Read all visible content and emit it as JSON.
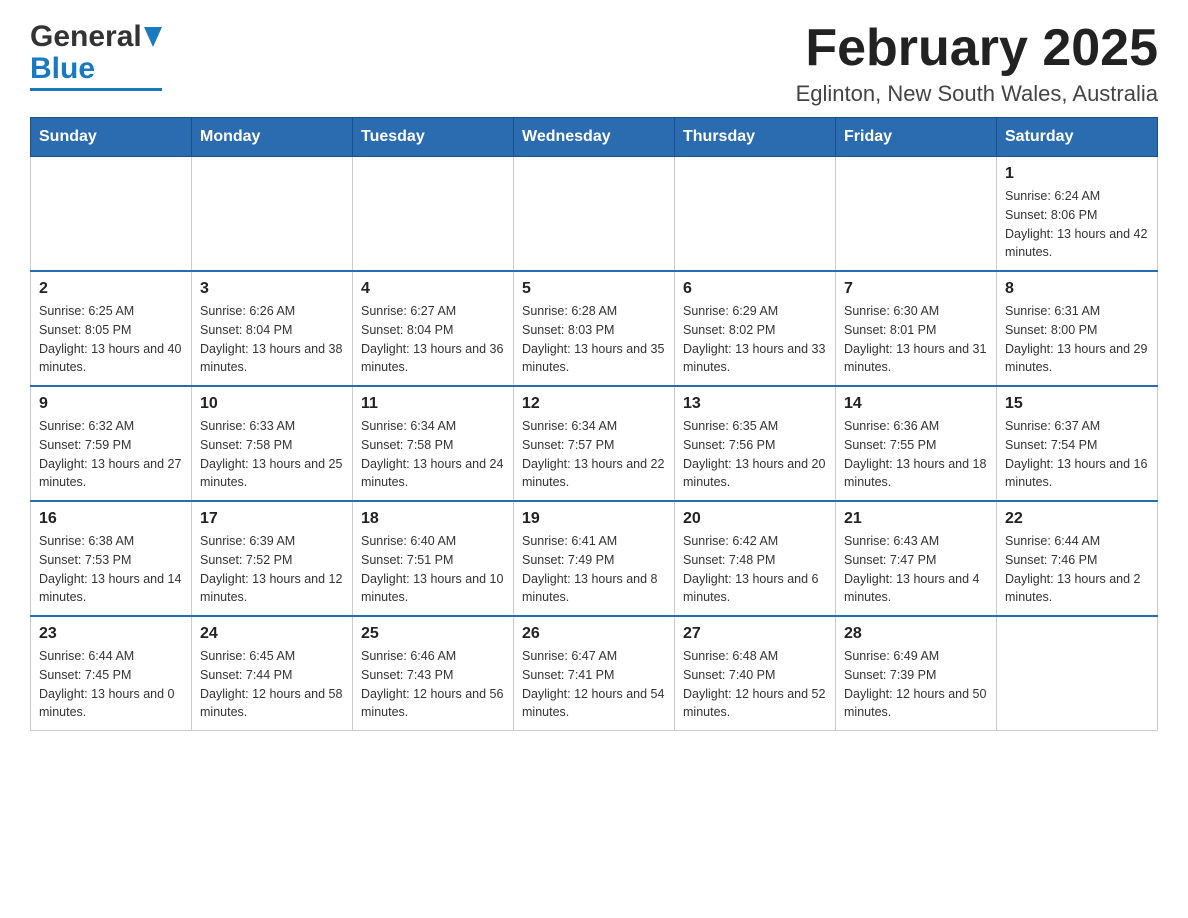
{
  "header": {
    "logo_general": "General",
    "logo_blue": "Blue",
    "title": "February 2025",
    "subtitle": "Eglinton, New South Wales, Australia"
  },
  "weekdays": [
    "Sunday",
    "Monday",
    "Tuesday",
    "Wednesday",
    "Thursday",
    "Friday",
    "Saturday"
  ],
  "weeks": [
    {
      "days": [
        {
          "num": "",
          "info": ""
        },
        {
          "num": "",
          "info": ""
        },
        {
          "num": "",
          "info": ""
        },
        {
          "num": "",
          "info": ""
        },
        {
          "num": "",
          "info": ""
        },
        {
          "num": "",
          "info": ""
        },
        {
          "num": "1",
          "info": "Sunrise: 6:24 AM\nSunset: 8:06 PM\nDaylight: 13 hours and 42 minutes."
        }
      ]
    },
    {
      "days": [
        {
          "num": "2",
          "info": "Sunrise: 6:25 AM\nSunset: 8:05 PM\nDaylight: 13 hours and 40 minutes."
        },
        {
          "num": "3",
          "info": "Sunrise: 6:26 AM\nSunset: 8:04 PM\nDaylight: 13 hours and 38 minutes."
        },
        {
          "num": "4",
          "info": "Sunrise: 6:27 AM\nSunset: 8:04 PM\nDaylight: 13 hours and 36 minutes."
        },
        {
          "num": "5",
          "info": "Sunrise: 6:28 AM\nSunset: 8:03 PM\nDaylight: 13 hours and 35 minutes."
        },
        {
          "num": "6",
          "info": "Sunrise: 6:29 AM\nSunset: 8:02 PM\nDaylight: 13 hours and 33 minutes."
        },
        {
          "num": "7",
          "info": "Sunrise: 6:30 AM\nSunset: 8:01 PM\nDaylight: 13 hours and 31 minutes."
        },
        {
          "num": "8",
          "info": "Sunrise: 6:31 AM\nSunset: 8:00 PM\nDaylight: 13 hours and 29 minutes."
        }
      ]
    },
    {
      "days": [
        {
          "num": "9",
          "info": "Sunrise: 6:32 AM\nSunset: 7:59 PM\nDaylight: 13 hours and 27 minutes."
        },
        {
          "num": "10",
          "info": "Sunrise: 6:33 AM\nSunset: 7:58 PM\nDaylight: 13 hours and 25 minutes."
        },
        {
          "num": "11",
          "info": "Sunrise: 6:34 AM\nSunset: 7:58 PM\nDaylight: 13 hours and 24 minutes."
        },
        {
          "num": "12",
          "info": "Sunrise: 6:34 AM\nSunset: 7:57 PM\nDaylight: 13 hours and 22 minutes."
        },
        {
          "num": "13",
          "info": "Sunrise: 6:35 AM\nSunset: 7:56 PM\nDaylight: 13 hours and 20 minutes."
        },
        {
          "num": "14",
          "info": "Sunrise: 6:36 AM\nSunset: 7:55 PM\nDaylight: 13 hours and 18 minutes."
        },
        {
          "num": "15",
          "info": "Sunrise: 6:37 AM\nSunset: 7:54 PM\nDaylight: 13 hours and 16 minutes."
        }
      ]
    },
    {
      "days": [
        {
          "num": "16",
          "info": "Sunrise: 6:38 AM\nSunset: 7:53 PM\nDaylight: 13 hours and 14 minutes."
        },
        {
          "num": "17",
          "info": "Sunrise: 6:39 AM\nSunset: 7:52 PM\nDaylight: 13 hours and 12 minutes."
        },
        {
          "num": "18",
          "info": "Sunrise: 6:40 AM\nSunset: 7:51 PM\nDaylight: 13 hours and 10 minutes."
        },
        {
          "num": "19",
          "info": "Sunrise: 6:41 AM\nSunset: 7:49 PM\nDaylight: 13 hours and 8 minutes."
        },
        {
          "num": "20",
          "info": "Sunrise: 6:42 AM\nSunset: 7:48 PM\nDaylight: 13 hours and 6 minutes."
        },
        {
          "num": "21",
          "info": "Sunrise: 6:43 AM\nSunset: 7:47 PM\nDaylight: 13 hours and 4 minutes."
        },
        {
          "num": "22",
          "info": "Sunrise: 6:44 AM\nSunset: 7:46 PM\nDaylight: 13 hours and 2 minutes."
        }
      ]
    },
    {
      "days": [
        {
          "num": "23",
          "info": "Sunrise: 6:44 AM\nSunset: 7:45 PM\nDaylight: 13 hours and 0 minutes."
        },
        {
          "num": "24",
          "info": "Sunrise: 6:45 AM\nSunset: 7:44 PM\nDaylight: 12 hours and 58 minutes."
        },
        {
          "num": "25",
          "info": "Sunrise: 6:46 AM\nSunset: 7:43 PM\nDaylight: 12 hours and 56 minutes."
        },
        {
          "num": "26",
          "info": "Sunrise: 6:47 AM\nSunset: 7:41 PM\nDaylight: 12 hours and 54 minutes."
        },
        {
          "num": "27",
          "info": "Sunrise: 6:48 AM\nSunset: 7:40 PM\nDaylight: 12 hours and 52 minutes."
        },
        {
          "num": "28",
          "info": "Sunrise: 6:49 AM\nSunset: 7:39 PM\nDaylight: 12 hours and 50 minutes."
        },
        {
          "num": "",
          "info": ""
        }
      ]
    }
  ]
}
